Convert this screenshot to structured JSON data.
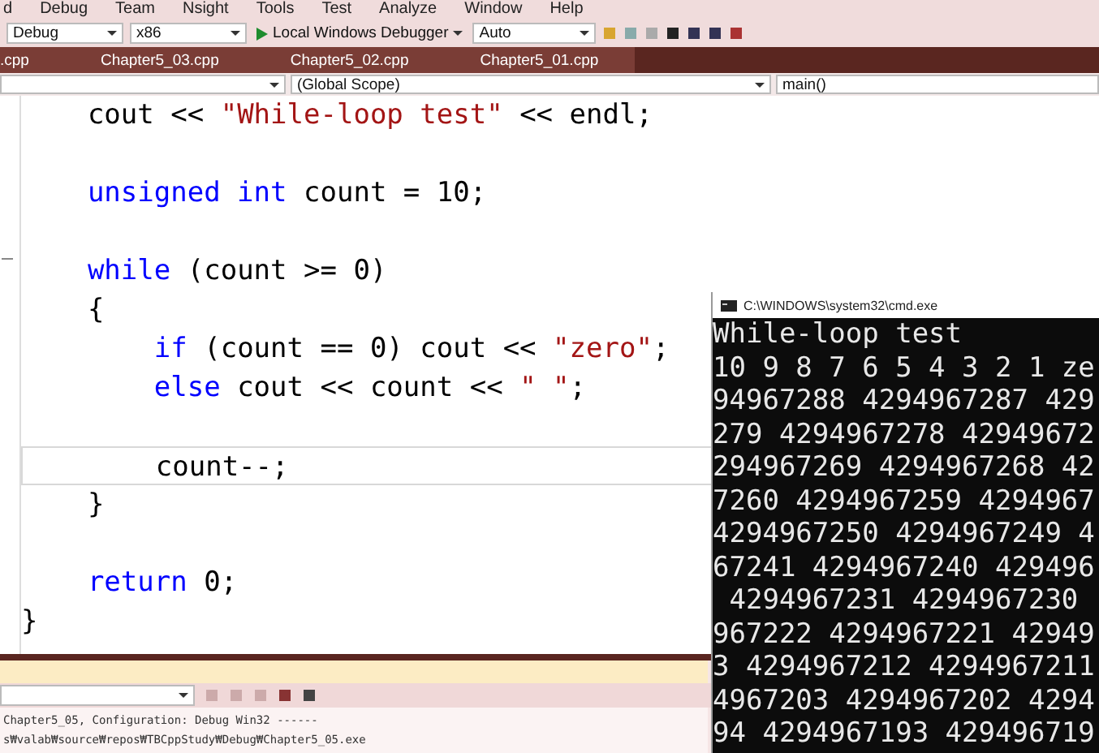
{
  "menu_bar": [
    "d",
    "Debug",
    "Team",
    "Nsight",
    "Tools",
    "Test",
    "Analyze",
    "Window",
    "Help"
  ],
  "toolbar": {
    "configuration": "Debug",
    "platform": "x86",
    "debugger": "Local Windows Debugger",
    "stack_frame": "Auto"
  },
  "tabs": [
    {
      "label": ".cpp",
      "selected": false
    },
    {
      "label": "Chapter5_03.cpp",
      "selected": false
    },
    {
      "label": "Chapter5_02.cpp",
      "selected": false
    },
    {
      "label": "Chapter5_01.cpp",
      "selected": false
    }
  ],
  "navigation_bar": {
    "scope": "(Global Scope)",
    "member": "main()"
  },
  "code_lines": [
    {
      "current": false,
      "tokens": [
        {
          "kind": "plain",
          "text": "    cout << "
        },
        {
          "kind": "string",
          "text": "\"While-loop test\""
        },
        {
          "kind": "plain",
          "text": " << endl;"
        }
      ]
    },
    {
      "current": false
    },
    {
      "current": false,
      "tokens": [
        {
          "kind": "keyword",
          "text": "    unsigned int"
        },
        {
          "kind": "plain",
          "text": " count = 10;"
        }
      ]
    },
    {
      "current": false
    },
    {
      "current": false,
      "tokens": [
        {
          "kind": "keyword",
          "text": "    while"
        },
        {
          "kind": "plain",
          "text": " (count >= 0)"
        }
      ]
    },
    {
      "current": false,
      "tokens": [
        {
          "kind": "plain",
          "text": "    {"
        }
      ]
    },
    {
      "current": false,
      "tokens": [
        {
          "kind": "keyword",
          "text": "        if"
        },
        {
          "kind": "plain",
          "text": " (count == 0) cout << "
        },
        {
          "kind": "string",
          "text": "\"zero\""
        },
        {
          "kind": "plain",
          "text": ";"
        }
      ]
    },
    {
      "current": false,
      "tokens": [
        {
          "kind": "keyword",
          "text": "        else"
        },
        {
          "kind": "plain",
          "text": " cout << count << "
        },
        {
          "kind": "string",
          "text": "\" \""
        },
        {
          "kind": "plain",
          "text": ";"
        }
      ]
    },
    {
      "current": false
    },
    {
      "current": true,
      "tokens": [
        {
          "kind": "plain",
          "text": "        count--;"
        }
      ]
    },
    {
      "current": false,
      "tokens": [
        {
          "kind": "plain",
          "text": "    }"
        }
      ]
    },
    {
      "current": false
    },
    {
      "current": false,
      "tokens": [
        {
          "kind": "keyword",
          "text": "    return"
        },
        {
          "kind": "plain",
          "text": " 0;"
        }
      ]
    },
    {
      "current": false,
      "tokens": [
        {
          "kind": "plain",
          "text": "}"
        }
      ]
    }
  ],
  "output": {
    "lines": [
      "Chapter5_05, Configuration: Debug Win32 ------",
      "s₩valab₩source₩repos₩TBCppStudy₩Debug₩Chapter5_05.exe"
    ]
  },
  "console": {
    "title": "C:\\WINDOWS\\system32\\cmd.exe",
    "lines": [
      "While-loop test",
      "10 9 8 7 6 5 4 3 2 1 ze",
      "94967288 4294967287 429",
      "279 4294967278 42949672",
      "294967269 4294967268 42",
      "7260 4294967259 4294967",
      "4294967250 4294967249 4",
      "67241 4294967240 429496",
      " 4294967231 4294967230 ",
      "967222 4294967221 42949",
      "3 4294967212 4294967211",
      "4967203 4294967202 4294",
      "94 4294967193 429496719"
    ]
  }
}
